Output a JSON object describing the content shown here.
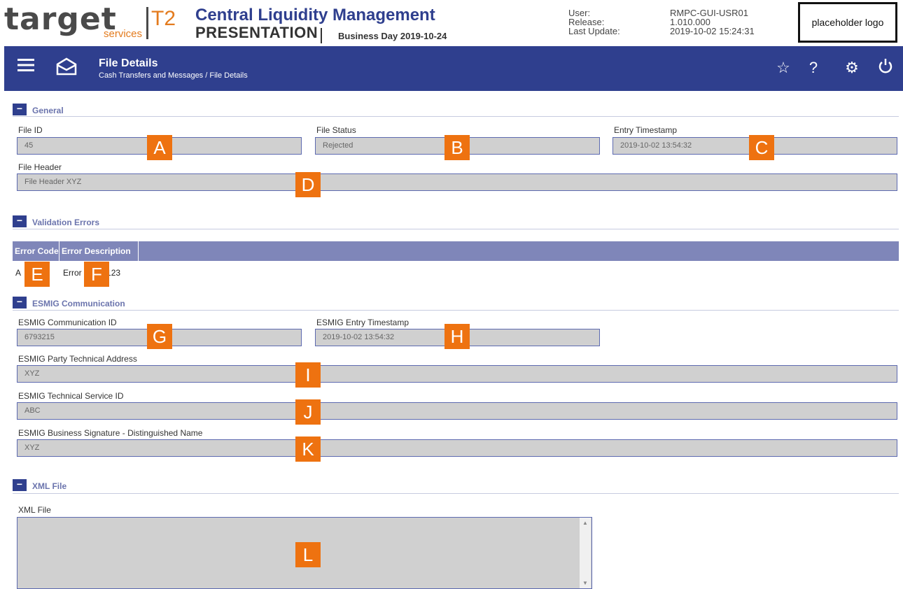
{
  "header": {
    "brand": "target",
    "brand_sub": "services",
    "t2": "T2",
    "app_title": "Central Liquidity Management",
    "mode": "PRESENTATION",
    "business_day": "Business Day 2019-10-24",
    "meta_labels": [
      "User:",
      "Release:",
      "Last Update:"
    ],
    "meta_values": [
      "RMPC-GUI-USR01",
      "1.010.000",
      "2019-10-02 15:24:31"
    ],
    "logo_text": "placeholder logo"
  },
  "navbar": {
    "title": "File Details",
    "breadcrumb": "Cash Transfers and Messages  /  File Details",
    "icons": [
      "menu-icon",
      "envelope-icon",
      "star-icon",
      "help-icon",
      "gear-icon",
      "power-icon"
    ]
  },
  "general": {
    "title": "General",
    "file_id_label": "File ID",
    "file_id": "45",
    "file_status_label": "File Status",
    "file_status": "Rejected",
    "entry_ts_label": "Entry Timestamp",
    "entry_ts": "2019-10-02 13:54:32",
    "file_header_label": "File Header",
    "file_header": "File Header XYZ"
  },
  "validation": {
    "title": "Validation Errors",
    "columns": [
      "Error Code",
      "Error Description"
    ],
    "rows": [
      [
        "A",
        "Error Code 123"
      ]
    ]
  },
  "esmig": {
    "title": "ESMIG Communication",
    "comm_id_label": "ESMIG Communication ID",
    "comm_id": "6793215",
    "entry_ts_label": "ESMIG Entry Timestamp",
    "entry_ts": "2019-10-02 13:54:32",
    "party_addr_label": "ESMIG Party Technical Address",
    "party_addr": "XYZ",
    "service_id_label": "ESMIG Technical Service ID",
    "service_id": "ABC",
    "signature_label": "ESMIG Business Signature - Distinguished Name",
    "signature": "XYZ"
  },
  "xml": {
    "title": "XML File",
    "label": "XML File",
    "content": ""
  },
  "markers": [
    "A",
    "B",
    "C",
    "D",
    "E",
    "F",
    "G",
    "H",
    "I",
    "J",
    "K",
    "L"
  ],
  "colors": {
    "navy": "#2f3f8e",
    "orange_marker": "#ee7210",
    "table_header": "#7f86b9",
    "field_bg": "#d0d0d0"
  }
}
